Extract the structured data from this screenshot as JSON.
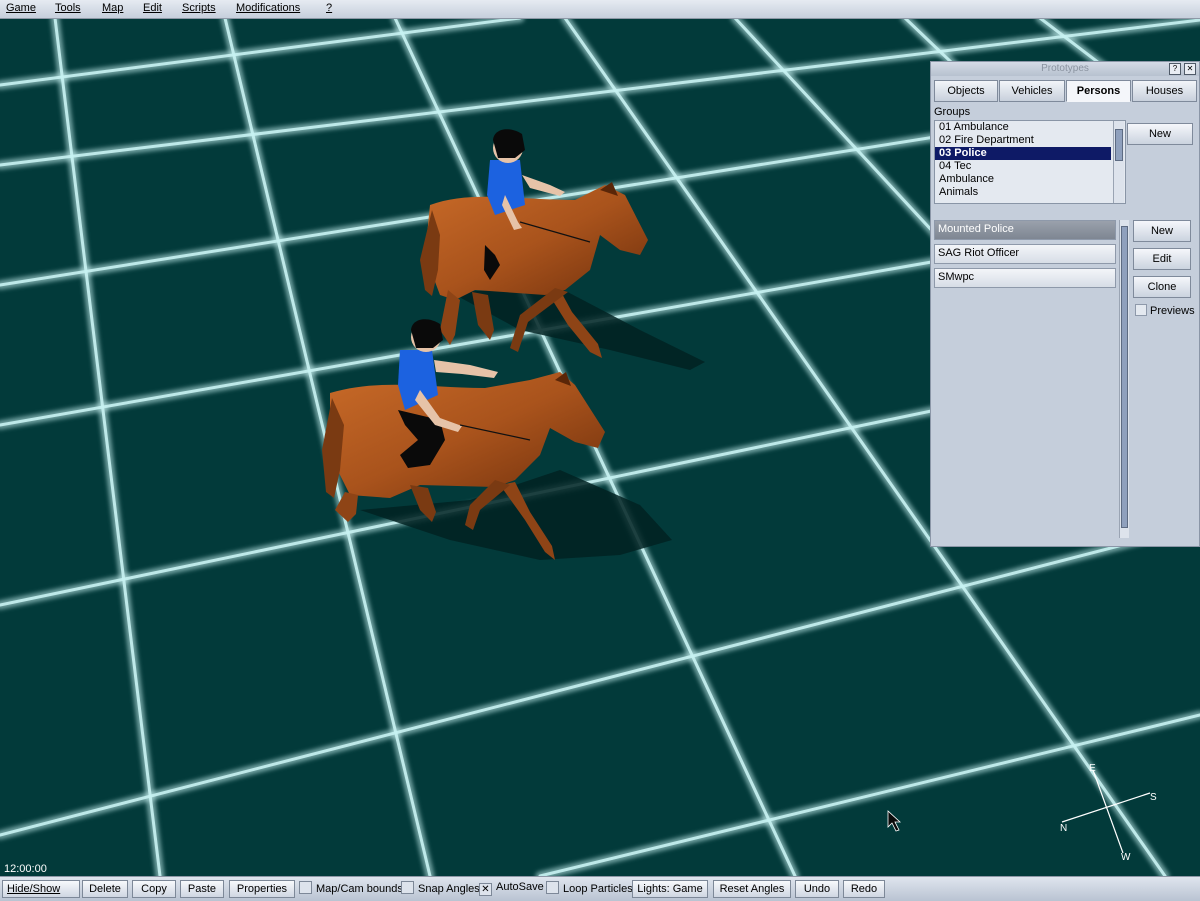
{
  "menu": [
    "Game",
    "Tools",
    "Map",
    "Edit",
    "Scripts",
    "Modifications",
    "?"
  ],
  "clock": "12:00:00",
  "compass": {
    "n": "N",
    "e": "E",
    "s": "S",
    "w": "W"
  },
  "panel": {
    "title": "Prototypes",
    "help": "?",
    "tabs": [
      "Objects",
      "Vehicles",
      "Persons",
      "Houses"
    ],
    "active_tab": "Persons",
    "groups_label": "Groups",
    "groups": [
      "01 Ambulance",
      "02 Fire Department",
      "03 Police",
      "04 Tec",
      "Ambulance",
      "Animals"
    ],
    "selected_group": "03 Police",
    "groups_new": "New",
    "prototypes": [
      "Mounted Police",
      "SAG Riot Officer",
      "SMwpc"
    ],
    "selected_prototype": "Mounted Police",
    "buttons": {
      "new": "New",
      "edit": "Edit",
      "clone": "Clone"
    },
    "previews_label": "Previews",
    "previews_checked": false
  },
  "toolbar": {
    "hide_show": "Hide/Show",
    "delete": "Delete",
    "copy": "Copy",
    "paste": "Paste",
    "properties": "Properties",
    "map_cam_bounds": "Map/Cam bounds",
    "snap_angles": "Snap Angles",
    "autosave": "AutoSave",
    "loop_particles": "Loop Particles",
    "lights": "Lights: Game",
    "reset_angles": "Reset Angles",
    "undo": "Undo",
    "redo": "Redo",
    "map_cam_bounds_checked": false,
    "snap_angles_checked": false,
    "autosave_checked": true,
    "loop_particles_checked": false
  },
  "colors": {
    "ground": "#023a3a",
    "grid": "#c8f2f2",
    "horse": "#a9531c",
    "shirt": "#1c62e0",
    "hair": "#0a0a0a",
    "selection": "#0e1a66"
  }
}
